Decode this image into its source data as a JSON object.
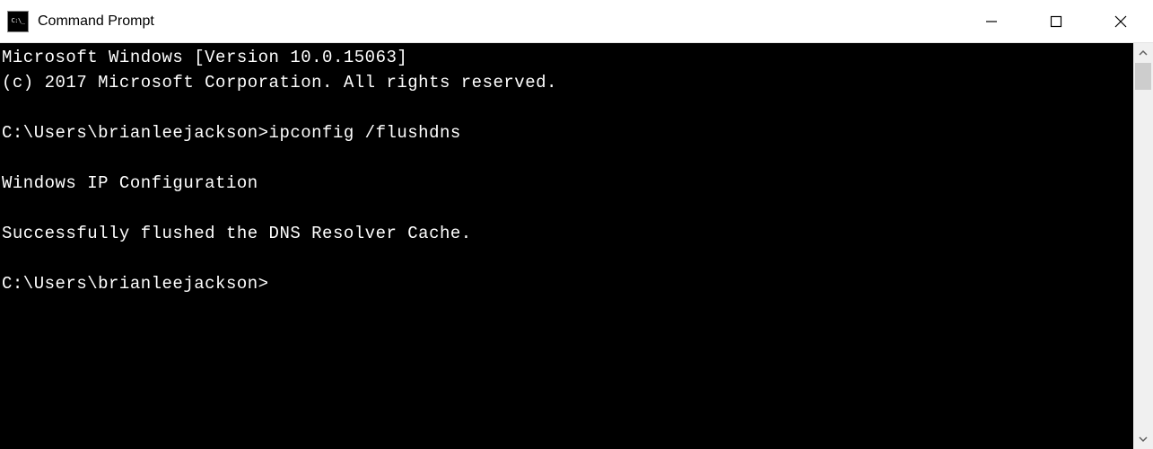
{
  "window": {
    "title": "Command Prompt"
  },
  "terminal": {
    "lines": [
      "Microsoft Windows [Version 10.0.15063]",
      "(c) 2017 Microsoft Corporation. All rights reserved.",
      "",
      "C:\\Users\\brianleejackson>ipconfig /flushdns",
      "",
      "Windows IP Configuration",
      "",
      "Successfully flushed the DNS Resolver Cache.",
      "",
      "C:\\Users\\brianleejackson>"
    ]
  }
}
